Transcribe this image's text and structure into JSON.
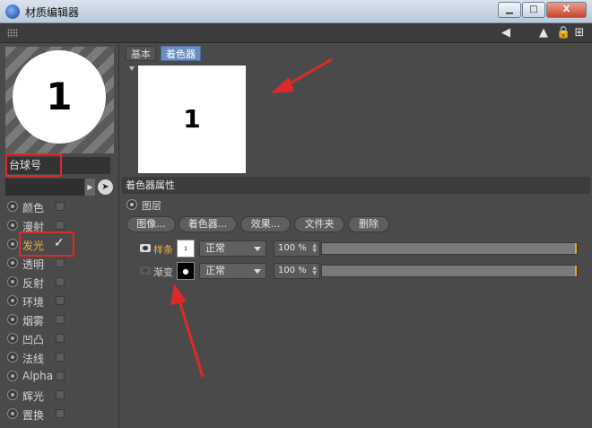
{
  "window": {
    "title": "材质编辑器",
    "min_label": "▁",
    "max_label": "□",
    "close_label": "X"
  },
  "left_panel": {
    "preview_text": "1",
    "material_name": "台球号",
    "channels": [
      {
        "label": "颜色",
        "enabled": false
      },
      {
        "label": "漫射",
        "enabled": false
      },
      {
        "label": "发光",
        "enabled": true
      },
      {
        "label": "透明",
        "enabled": false
      },
      {
        "label": "反射",
        "enabled": false
      },
      {
        "label": "环境",
        "enabled": false
      },
      {
        "label": "烟雾",
        "enabled": false
      },
      {
        "label": "凹凸",
        "enabled": false
      },
      {
        "label": "法线",
        "enabled": false
      },
      {
        "label": "Alpha",
        "enabled": false
      },
      {
        "label": "辉光",
        "enabled": false
      },
      {
        "label": "置换",
        "enabled": false
      }
    ],
    "check_mark": "✓"
  },
  "right_panel": {
    "tabs": [
      {
        "label": "基本",
        "active": false
      },
      {
        "label": "着色器",
        "active": true
      }
    ],
    "preview_text": "1",
    "section_title": "着色器属性",
    "layer_label": "图层",
    "buttons": [
      "图像...",
      "着色器...",
      "效果...",
      "文件夹",
      "删除"
    ],
    "layers": [
      {
        "name": "样条",
        "thumb": "1",
        "mode": "正常",
        "opacity": "100 %",
        "opacity_value": 1.0,
        "visible": true,
        "highlight_color": "#f0b040"
      },
      {
        "name": "渐变",
        "thumb": "●",
        "mode": "正常",
        "opacity": "100 %",
        "opacity_value": 1.0,
        "visible": false,
        "highlight_color": "#d2d2d2"
      }
    ]
  },
  "colors": {
    "panel_bg": "#4a4a4a",
    "active_tab": "#6c8fbf",
    "highlight_text": "#f0b040",
    "annotation_red": "#e02828"
  }
}
